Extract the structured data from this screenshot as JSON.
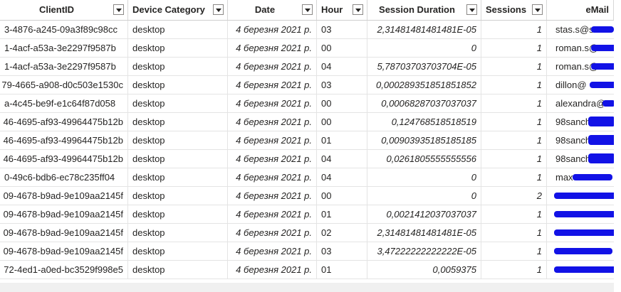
{
  "columns": [
    {
      "label": "ClientID"
    },
    {
      "label": "Device Category"
    },
    {
      "label": "Date"
    },
    {
      "label": "Hour"
    },
    {
      "label": "Session Duration"
    },
    {
      "label": "Sessions"
    },
    {
      "label": "eMail"
    }
  ],
  "rows": [
    {
      "clientid": "3-4876-a245-09a3f89c98cc",
      "device": "desktop",
      "date": "4 березня 2021 р.",
      "hour": "03",
      "duration": "2,31481481481481E-05",
      "sessions": "1",
      "email": "stas.s@s"
    },
    {
      "clientid": "1-4acf-a53a-3e2297f9587b",
      "device": "desktop",
      "date": "4 березня 2021 р.",
      "hour": "00",
      "duration": "0",
      "sessions": "1",
      "email": "roman.s@"
    },
    {
      "clientid": "1-4acf-a53a-3e2297f9587b",
      "device": "desktop",
      "date": "4 березня 2021 р.",
      "hour": "04",
      "duration": "5,78703703703704E-05",
      "sessions": "1",
      "email": "roman.s@"
    },
    {
      "clientid": "79-4665-a908-d0c503e1530c",
      "device": "desktop",
      "date": "4 березня 2021 р.",
      "hour": "03",
      "duration": "0,000289351851851852",
      "sessions": "1",
      "email": "dillon@"
    },
    {
      "clientid": "a-4c45-be9f-e1c64f87d058",
      "device": "desktop",
      "date": "4 березня 2021 р.",
      "hour": "00",
      "duration": "0,00068287037037037",
      "sessions": "1",
      "email": "alexandra@"
    },
    {
      "clientid": "46-4695-af93-49964475b12b",
      "device": "desktop",
      "date": "4 березня 2021 р.",
      "hour": "00",
      "duration": "0,124768518518519",
      "sessions": "1",
      "email": "98sanch"
    },
    {
      "clientid": "46-4695-af93-49964475b12b",
      "device": "desktop",
      "date": "4 березня 2021 р.",
      "hour": "01",
      "duration": "0,00903935185185185",
      "sessions": "1",
      "email": "98sanch"
    },
    {
      "clientid": "46-4695-af93-49964475b12b",
      "device": "desktop",
      "date": "4 березня 2021 р.",
      "hour": "04",
      "duration": "0,0261805555555556",
      "sessions": "1",
      "email": "98sanch"
    },
    {
      "clientid": "0-49c6-bdb6-ec78c235ff04",
      "device": "desktop",
      "date": "4 березня 2021 р.",
      "hour": "04",
      "duration": "0",
      "sessions": "1",
      "email": "max"
    },
    {
      "clientid": "09-4678-b9ad-9e109aa2145f",
      "device": "desktop",
      "date": "4 березня 2021 р.",
      "hour": "00",
      "duration": "0",
      "sessions": "2",
      "email": ""
    },
    {
      "clientid": "09-4678-b9ad-9e109aa2145f",
      "device": "desktop",
      "date": "4 березня 2021 р.",
      "hour": "01",
      "duration": "0,0021412037037037",
      "sessions": "1",
      "email": ""
    },
    {
      "clientid": "09-4678-b9ad-9e109aa2145f",
      "device": "desktop",
      "date": "4 березня 2021 р.",
      "hour": "02",
      "duration": "2,31481481481481E-05",
      "sessions": "1",
      "email": ""
    },
    {
      "clientid": "09-4678-b9ad-9e109aa2145f",
      "device": "desktop",
      "date": "4 березня 2021 р.",
      "hour": "03",
      "duration": "3,47222222222222E-05",
      "sessions": "1",
      "email": ""
    },
    {
      "clientid": "72-4ed1-a0ed-bc3529f998e5",
      "device": "desktop",
      "date": "4 березня 2021 р.",
      "hour": "01",
      "duration": "0,0059375",
      "sessions": "1",
      "email": ""
    }
  ],
  "colors": {
    "redaction": "#1212e6",
    "grid_line": "#e4e4e4",
    "text": "#252423"
  }
}
